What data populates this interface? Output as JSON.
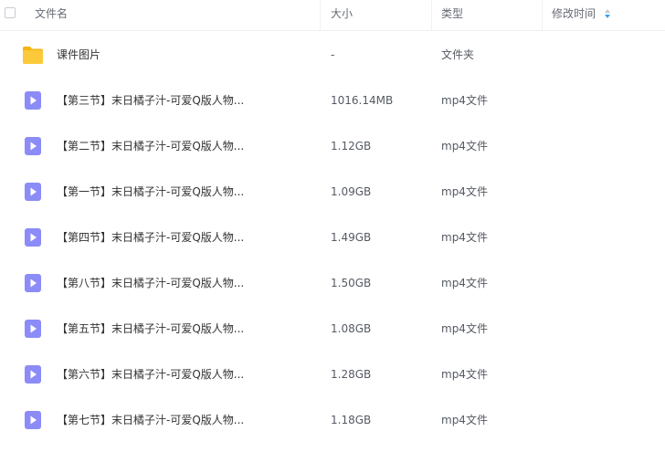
{
  "header": {
    "name_label": "文件名",
    "size_label": "大小",
    "type_label": "类型",
    "time_label": "修改时间"
  },
  "rows": [
    {
      "name": "课件图片",
      "size": "-",
      "type": "文件夹",
      "icon": "folder-icon"
    },
    {
      "name": "【第三节】末日橘子汁-可爱Q版人物...",
      "size": "1016.14MB",
      "type": "mp4文件",
      "icon": "video-file-icon"
    },
    {
      "name": "【第二节】末日橘子汁-可爱Q版人物...",
      "size": "1.12GB",
      "type": "mp4文件",
      "icon": "video-file-icon"
    },
    {
      "name": "【第一节】末日橘子汁-可爱Q版人物...",
      "size": "1.09GB",
      "type": "mp4文件",
      "icon": "video-file-icon"
    },
    {
      "name": "【第四节】末日橘子汁-可爱Q版人物...",
      "size": "1.49GB",
      "type": "mp4文件",
      "icon": "video-file-icon"
    },
    {
      "name": "【第八节】末日橘子汁-可爱Q版人物...",
      "size": "1.50GB",
      "type": "mp4文件",
      "icon": "video-file-icon"
    },
    {
      "name": "【第五节】末日橘子汁-可爱Q版人物...",
      "size": "1.08GB",
      "type": "mp4文件",
      "icon": "video-file-icon"
    },
    {
      "name": "【第六节】末日橘子汁-可爱Q版人物...",
      "size": "1.28GB",
      "type": "mp4文件",
      "icon": "video-file-icon"
    },
    {
      "name": "【第七节】末日橘子汁-可爱Q版人物...",
      "size": "1.18GB",
      "type": "mp4文件",
      "icon": "video-file-icon"
    }
  ],
  "colors": {
    "folder": "#fcc419",
    "video": "#8b8cf7",
    "sort_arrow": "#3aa0ee"
  }
}
